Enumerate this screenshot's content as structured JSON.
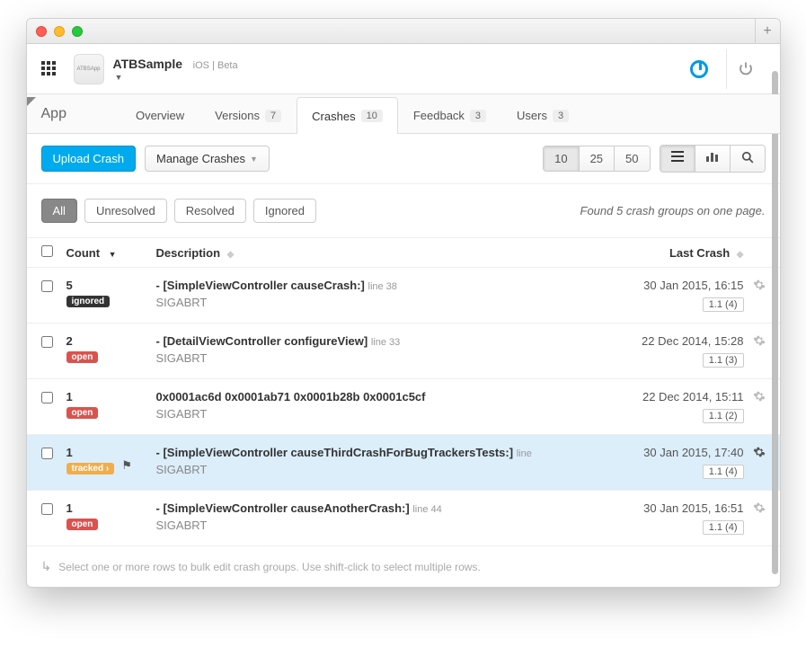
{
  "app": {
    "logo_text": "ATBSApp",
    "name": "ATBSample",
    "platform": "iOS | Beta"
  },
  "section_label": "App",
  "tabs": [
    {
      "label": "Overview",
      "badge": ""
    },
    {
      "label": "Versions",
      "badge": "7"
    },
    {
      "label": "Crashes",
      "badge": "10"
    },
    {
      "label": "Feedback",
      "badge": "3"
    },
    {
      "label": "Users",
      "badge": "3"
    }
  ],
  "toolbar": {
    "upload": "Upload Crash",
    "manage": "Manage Crashes",
    "pagesize": [
      "10",
      "25",
      "50"
    ]
  },
  "filters": {
    "all": "All",
    "unresolved": "Unresolved",
    "resolved": "Resolved",
    "ignored": "Ignored",
    "found": "Found 5 crash groups on one page."
  },
  "columns": {
    "count": "Count",
    "description": "Description",
    "last": "Last Crash"
  },
  "rows": [
    {
      "count": "5",
      "status": "ignored",
      "status_class": "tag-ignored",
      "title": "- [SimpleViewController causeCrash:]",
      "line": "line 38",
      "sub": "SIGABRT",
      "last": "30 Jan 2015, 16:15",
      "ver": "1.1 (4)",
      "selected": false,
      "flag": false
    },
    {
      "count": "2",
      "status": "open",
      "status_class": "tag-open",
      "title": "- [DetailViewController configureView]",
      "line": "line 33",
      "sub": "SIGABRT",
      "last": "22 Dec 2014, 15:28",
      "ver": "1.1 (3)",
      "selected": false,
      "flag": false
    },
    {
      "count": "1",
      "status": "open",
      "status_class": "tag-open",
      "title": "0x0001ac6d 0x0001ab71 0x0001b28b 0x0001c5cf",
      "line": "",
      "sub": "SIGABRT",
      "last": "22 Dec 2014, 15:11",
      "ver": "1.1 (2)",
      "selected": false,
      "flag": false
    },
    {
      "count": "1",
      "status": "tracked ›",
      "status_class": "tag-tracked",
      "title": "- [SimpleViewController causeThirdCrashForBugTrackersTests:]",
      "line": "line",
      "sub": "SIGABRT",
      "last": "30 Jan 2015, 17:40",
      "ver": "1.1 (4)",
      "selected": true,
      "flag": true
    },
    {
      "count": "1",
      "status": "open",
      "status_class": "tag-open",
      "title": "- [SimpleViewController causeAnotherCrash:]",
      "line": "line 44",
      "sub": "SIGABRT",
      "last": "30 Jan 2015, 16:51",
      "ver": "1.1 (4)",
      "selected": false,
      "flag": false
    }
  ],
  "footer_hint": "Select one or more rows to bulk edit crash groups. Use shift-click to select multiple rows."
}
